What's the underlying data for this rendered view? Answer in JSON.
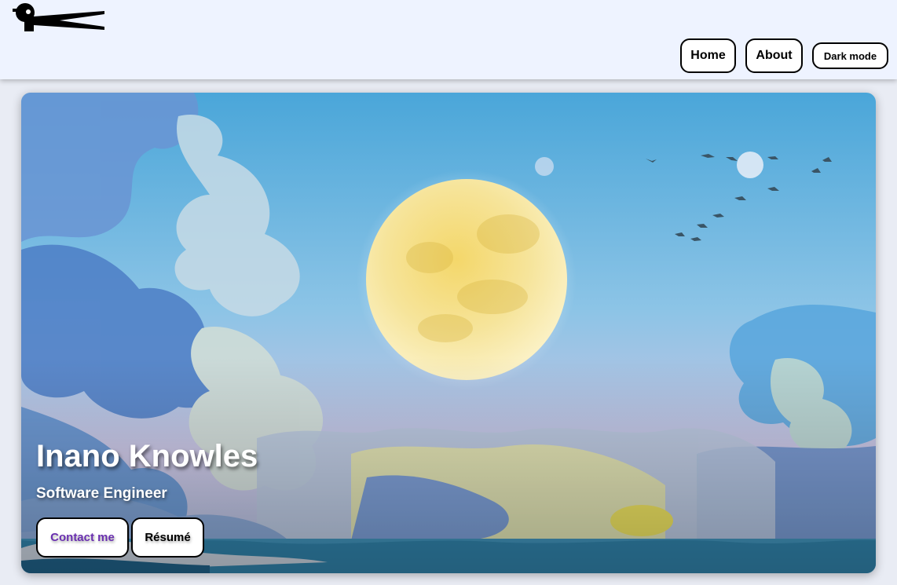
{
  "header": {
    "logo_alt": "logo",
    "nav": {
      "home_label": "Home",
      "about_label": "About",
      "dark_mode_label": "Dark mode"
    }
  },
  "hero": {
    "name": "Inano Knowles",
    "title": "Software Engineer",
    "buttons": {
      "contact_label": "Contact me",
      "resume_label": "Résumé"
    },
    "background_description_colors": {
      "sky": "#56aee0",
      "moon": "#f3de7a",
      "cloud": "#b9d7ea",
      "sea": "#2f7fa6"
    }
  },
  "colors": {
    "header_bg": "#eef3ff",
    "page_bg": "#e9ecf4",
    "contact_text": "#6a2fb0"
  }
}
